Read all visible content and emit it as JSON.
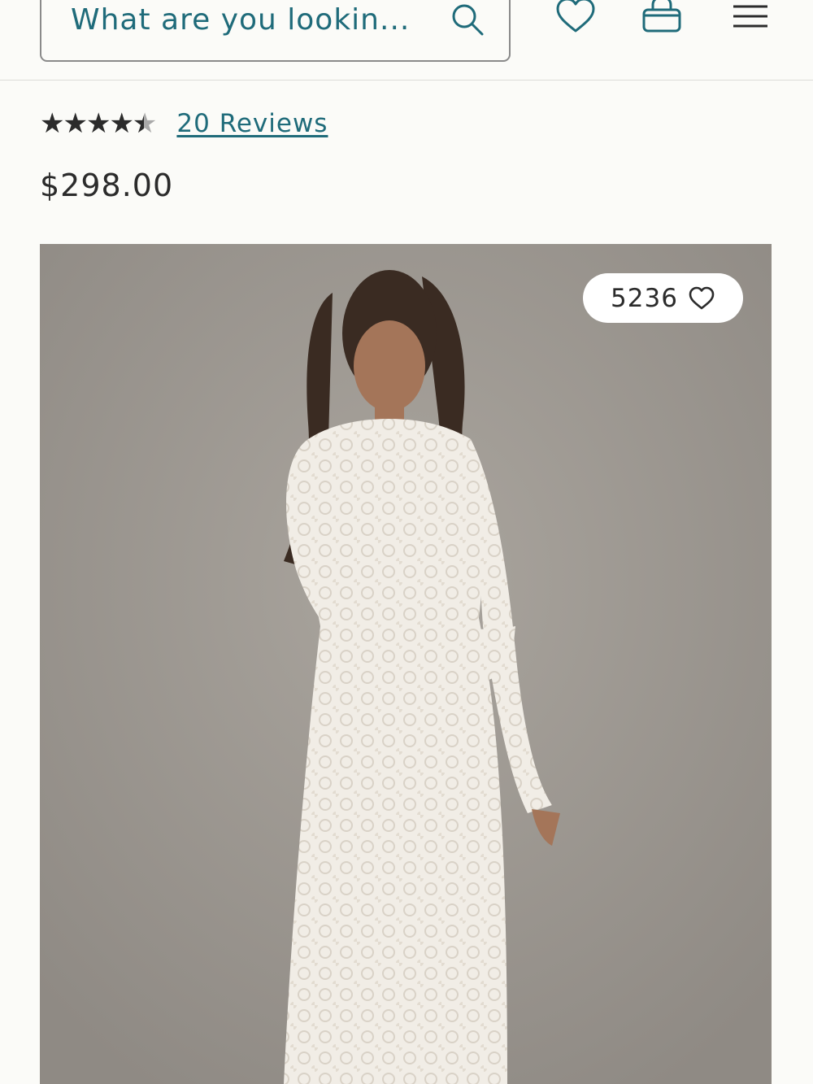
{
  "header": {
    "search_placeholder": "What are you lookin...",
    "icons": [
      "search-icon",
      "heart-icon",
      "bag-icon",
      "menu-icon"
    ]
  },
  "product": {
    "rating": 4.5,
    "rating_max": 5,
    "reviews_label": "20 Reviews",
    "price": "$298.00",
    "image_alt": "Model wearing long-sleeve white lace gown",
    "like_count": "5236"
  },
  "colors": {
    "accent": "#1f6b7a",
    "text": "#2b2b2b",
    "background": "#fbfbf8",
    "photo_bg": "#9a958e"
  }
}
